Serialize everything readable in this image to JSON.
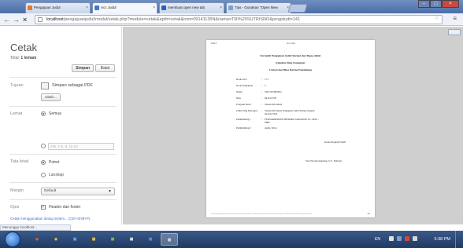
{
  "tabs": [
    {
      "label": "Pengajuan Judul",
      "color": "#e4792b"
    },
    {
      "label": "Acc Judul",
      "color": "#4a77c4"
    },
    {
      "label": "membuat open new tab",
      "color": "#2b5fbf"
    },
    {
      "label": "Tips - Gunakan \"Open New",
      "color": "#7aa0d0"
    }
  ],
  "toolbar": {
    "back_icon": "back-arrow-icon",
    "forward_icon": "forward-arrow-icon",
    "stop_icon": "stop-x-icon",
    "url_host": "localhost",
    "url_rest": "/pengajuanjudul/modul/cetak.php?module=cetak&epth=cetak&nim=09141135N&nama=TRI%20SUTRISNO&progstudi=141"
  },
  "print_panel": {
    "title": "Cetak",
    "total_label": "Total:",
    "total_value": "1 lemam",
    "save_button": "Simpan",
    "cancel_button": "Batal",
    "destination_label": "Tujuan",
    "destination_value": "Simpan sebagai PDF",
    "change_button": "Ubah...",
    "pages_label": "Lemat",
    "pages_all": "Semua",
    "pages_placeholder": "mis. 1-5, 8, 11-13",
    "layout_label": "Tata letak",
    "layout_portrait": "Potret",
    "layout_landscape": "Lanskap",
    "margin_label": "Margin",
    "margin_value": "Default",
    "options_label": "Opsi",
    "header_footer": "Header dan footer",
    "system_dialog_link": "Cetak menggunakan dialog sistem... (Ctrl+Shift+P)"
  },
  "document": {
    "header_left": "9/4/13",
    "header_center": "Acc Judul",
    "heading_line1": "Formulir Pengajuan Judul Skripsi dan Tugas Akhir",
    "heading_line2": "Fakultas Ilmu Komputer",
    "heading_line3": "Universitas Bina Darma Palembang",
    "fields": [
      {
        "key": "Kode ACC",
        "value": "171"
      },
      {
        "key": "Kode Pengajuan",
        "value": "5"
      },
      {
        "key": "Nama",
        "value": "TRI SUTRISNO"
      },
      {
        "key": "Nim",
        "value": "09141135N"
      },
      {
        "key": "Program Studi",
        "value": "Sistem Informasi"
      },
      {
        "key": "Judul Yang Disetujui",
        "value": "Sistem Informasi Pengajuan Judul Skripsi dengan metode SDA"
      },
      {
        "key": "Pembimbing 1",
        "value": "PERSADIRSIDIN HENDRO SAKSONO ST., MSC., PHD"
      },
      {
        "key": "Pembimbing 2",
        "value": "Andri, M.Cs"
      }
    ],
    "signature_title": "Ketua Program Studi",
    "signature_name": "Yesi Novaria Kunang, S.T., M.Kom",
    "footer_url": "localhost/pengajuanjudul/modul/cetak.php?module=cetak&epth=cetak&nim=09141135N&nama=TRI%20SUTRISNO&progstudi=141",
    "page_number": "1/1"
  },
  "status": {
    "text": "Menunggu localhost..."
  },
  "taskbar": {
    "apps": [
      {
        "icon": "media-player-icon",
        "color": "#e05a2a"
      },
      {
        "icon": "chrome-icon",
        "color": "#d8c13a"
      },
      {
        "icon": "explorer-icon",
        "color": "#5aa0e0"
      },
      {
        "icon": "folder-icon",
        "color": "#e0b84a"
      },
      {
        "icon": "paint-icon",
        "color": "#7ab84a"
      },
      {
        "icon": "notepad-icon",
        "color": "#cfd8e0"
      },
      {
        "icon": "photo-icon",
        "color": "#4a90d0"
      },
      {
        "icon": "firefox-icon",
        "color": "#e07a2a"
      },
      {
        "icon": "print-window-icon",
        "color": "#c8d0dc"
      }
    ],
    "lang": "EN",
    "time": "5:38 PM"
  }
}
